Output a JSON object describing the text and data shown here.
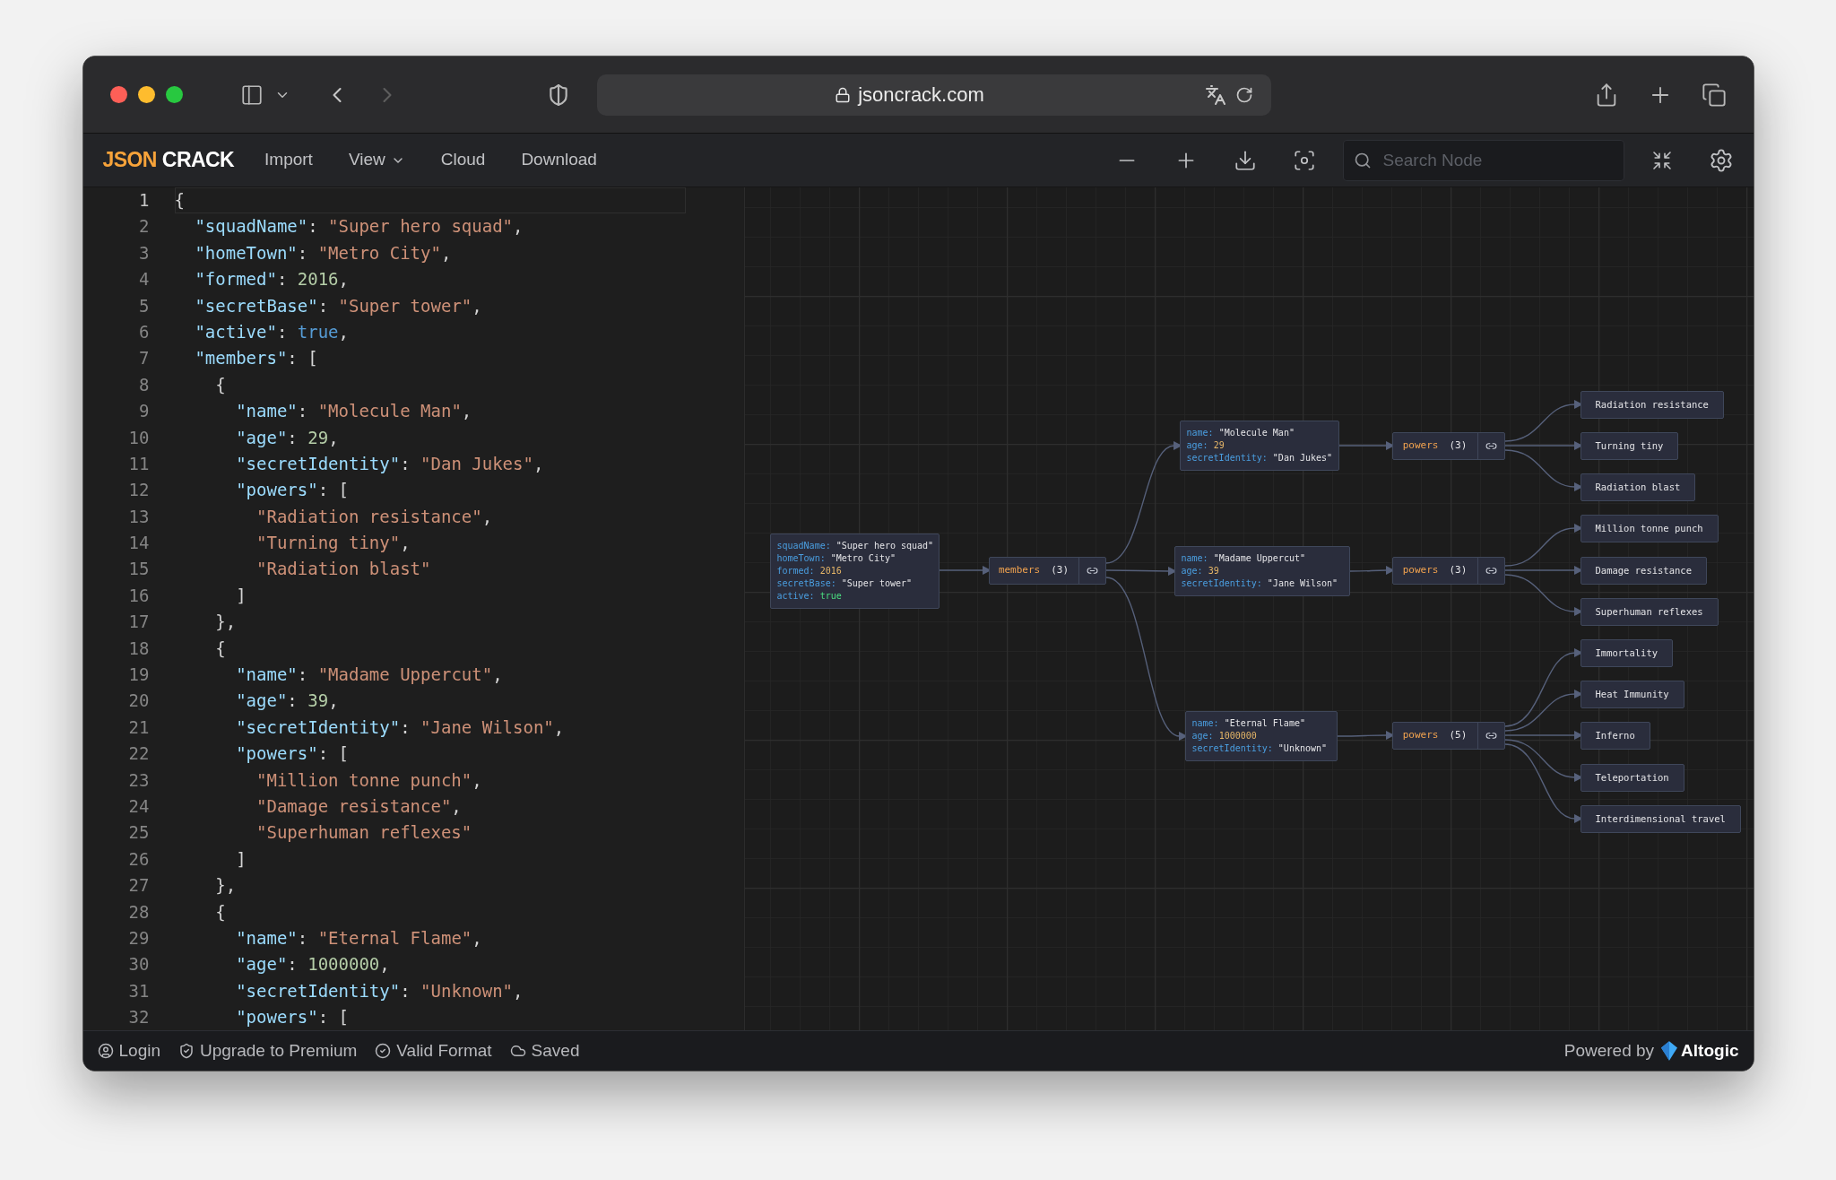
{
  "browser": {
    "url": "jsoncrack.com",
    "forward_disabled": true
  },
  "toolbar": {
    "logo_accent": "JSON",
    "logo_rest": "CRACK",
    "menu": [
      {
        "label": "Import",
        "dropdown": false
      },
      {
        "label": "View",
        "dropdown": true
      },
      {
        "label": "Cloud",
        "dropdown": false
      },
      {
        "label": "Download",
        "dropdown": false
      }
    ],
    "search": {
      "placeholder": "Search Node"
    }
  },
  "editor": {
    "lines": [
      {
        "number": "1",
        "current": true,
        "tokens": [
          {
            "kind": "punct",
            "text": "{"
          }
        ]
      },
      {
        "number": "2",
        "current": false,
        "tokens": [
          {
            "kind": "key",
            "text": "  \"squadName\""
          },
          {
            "kind": "punct",
            "text": ": "
          },
          {
            "kind": "string",
            "text": "\"Super hero squad\""
          },
          {
            "kind": "punct",
            "text": ","
          }
        ]
      },
      {
        "number": "3",
        "current": false,
        "tokens": [
          {
            "kind": "key",
            "text": "  \"homeTown\""
          },
          {
            "kind": "punct",
            "text": ": "
          },
          {
            "kind": "string",
            "text": "\"Metro City\""
          },
          {
            "kind": "punct",
            "text": ","
          }
        ]
      },
      {
        "number": "4",
        "current": false,
        "tokens": [
          {
            "kind": "key",
            "text": "  \"formed\""
          },
          {
            "kind": "punct",
            "text": ": "
          },
          {
            "kind": "number",
            "text": "2016"
          },
          {
            "kind": "punct",
            "text": ","
          }
        ]
      },
      {
        "number": "5",
        "current": false,
        "tokens": [
          {
            "kind": "key",
            "text": "  \"secretBase\""
          },
          {
            "kind": "punct",
            "text": ": "
          },
          {
            "kind": "string",
            "text": "\"Super tower\""
          },
          {
            "kind": "punct",
            "text": ","
          }
        ]
      },
      {
        "number": "6",
        "current": false,
        "tokens": [
          {
            "kind": "key",
            "text": "  \"active\""
          },
          {
            "kind": "punct",
            "text": ": "
          },
          {
            "kind": "bool",
            "text": "true"
          },
          {
            "kind": "punct",
            "text": ","
          }
        ]
      },
      {
        "number": "7",
        "current": false,
        "tokens": [
          {
            "kind": "key",
            "text": "  \"members\""
          },
          {
            "kind": "punct",
            "text": ": ["
          }
        ]
      },
      {
        "number": "8",
        "current": false,
        "tokens": [
          {
            "kind": "punct",
            "text": "    {"
          }
        ]
      },
      {
        "number": "9",
        "current": false,
        "tokens": [
          {
            "kind": "key",
            "text": "      \"name\""
          },
          {
            "kind": "punct",
            "text": ": "
          },
          {
            "kind": "string",
            "text": "\"Molecule Man\""
          },
          {
            "kind": "punct",
            "text": ","
          }
        ]
      },
      {
        "number": "10",
        "current": false,
        "tokens": [
          {
            "kind": "key",
            "text": "      \"age\""
          },
          {
            "kind": "punct",
            "text": ": "
          },
          {
            "kind": "number",
            "text": "29"
          },
          {
            "kind": "punct",
            "text": ","
          }
        ]
      },
      {
        "number": "11",
        "current": false,
        "tokens": [
          {
            "kind": "key",
            "text": "      \"secretIdentity\""
          },
          {
            "kind": "punct",
            "text": ": "
          },
          {
            "kind": "string",
            "text": "\"Dan Jukes\""
          },
          {
            "kind": "punct",
            "text": ","
          }
        ]
      },
      {
        "number": "12",
        "current": false,
        "tokens": [
          {
            "kind": "key",
            "text": "      \"powers\""
          },
          {
            "kind": "punct",
            "text": ": ["
          }
        ]
      },
      {
        "number": "13",
        "current": false,
        "tokens": [
          {
            "kind": "string",
            "text": "        \"Radiation resistance\""
          },
          {
            "kind": "punct",
            "text": ","
          }
        ]
      },
      {
        "number": "14",
        "current": false,
        "tokens": [
          {
            "kind": "string",
            "text": "        \"Turning tiny\""
          },
          {
            "kind": "punct",
            "text": ","
          }
        ]
      },
      {
        "number": "15",
        "current": false,
        "tokens": [
          {
            "kind": "string",
            "text": "        \"Radiation blast\""
          }
        ]
      },
      {
        "number": "16",
        "current": false,
        "tokens": [
          {
            "kind": "punct",
            "text": "      ]"
          }
        ]
      },
      {
        "number": "17",
        "current": false,
        "tokens": [
          {
            "kind": "punct",
            "text": "    },"
          }
        ]
      },
      {
        "number": "18",
        "current": false,
        "tokens": [
          {
            "kind": "punct",
            "text": "    {"
          }
        ]
      },
      {
        "number": "19",
        "current": false,
        "tokens": [
          {
            "kind": "key",
            "text": "      \"name\""
          },
          {
            "kind": "punct",
            "text": ": "
          },
          {
            "kind": "string",
            "text": "\"Madame Uppercut\""
          },
          {
            "kind": "punct",
            "text": ","
          }
        ]
      },
      {
        "number": "20",
        "current": false,
        "tokens": [
          {
            "kind": "key",
            "text": "      \"age\""
          },
          {
            "kind": "punct",
            "text": ": "
          },
          {
            "kind": "number",
            "text": "39"
          },
          {
            "kind": "punct",
            "text": ","
          }
        ]
      },
      {
        "number": "21",
        "current": false,
        "tokens": [
          {
            "kind": "key",
            "text": "      \"secretIdentity\""
          },
          {
            "kind": "punct",
            "text": ": "
          },
          {
            "kind": "string",
            "text": "\"Jane Wilson\""
          },
          {
            "kind": "punct",
            "text": ","
          }
        ]
      },
      {
        "number": "22",
        "current": false,
        "tokens": [
          {
            "kind": "key",
            "text": "      \"powers\""
          },
          {
            "kind": "punct",
            "text": ": ["
          }
        ]
      },
      {
        "number": "23",
        "current": false,
        "tokens": [
          {
            "kind": "string",
            "text": "        \"Million tonne punch\""
          },
          {
            "kind": "punct",
            "text": ","
          }
        ]
      },
      {
        "number": "24",
        "current": false,
        "tokens": [
          {
            "kind": "string",
            "text": "        \"Damage resistance\""
          },
          {
            "kind": "punct",
            "text": ","
          }
        ]
      },
      {
        "number": "25",
        "current": false,
        "tokens": [
          {
            "kind": "string",
            "text": "        \"Superhuman reflexes\""
          }
        ]
      },
      {
        "number": "26",
        "current": false,
        "tokens": [
          {
            "kind": "punct",
            "text": "      ]"
          }
        ]
      },
      {
        "number": "27",
        "current": false,
        "tokens": [
          {
            "kind": "punct",
            "text": "    },"
          }
        ]
      },
      {
        "number": "28",
        "current": false,
        "tokens": [
          {
            "kind": "punct",
            "text": "    {"
          }
        ]
      },
      {
        "number": "29",
        "current": false,
        "tokens": [
          {
            "kind": "key",
            "text": "      \"name\""
          },
          {
            "kind": "punct",
            "text": ": "
          },
          {
            "kind": "string",
            "text": "\"Eternal Flame\""
          },
          {
            "kind": "punct",
            "text": ","
          }
        ]
      },
      {
        "number": "30",
        "current": false,
        "tokens": [
          {
            "kind": "key",
            "text": "      \"age\""
          },
          {
            "kind": "punct",
            "text": ": "
          },
          {
            "kind": "number",
            "text": "1000000"
          },
          {
            "kind": "punct",
            "text": ","
          }
        ]
      },
      {
        "number": "31",
        "current": false,
        "tokens": [
          {
            "kind": "key",
            "text": "      \"secretIdentity\""
          },
          {
            "kind": "punct",
            "text": ": "
          },
          {
            "kind": "string",
            "text": "\"Unknown\""
          },
          {
            "kind": "punct",
            "text": ","
          }
        ]
      },
      {
        "number": "32",
        "current": false,
        "tokens": [
          {
            "kind": "key",
            "text": "      \"powers\""
          },
          {
            "kind": "punct",
            "text": ": ["
          }
        ]
      }
    ]
  },
  "graph": {
    "root": {
      "fields": [
        {
          "key": "squadName:",
          "value": "\"Super hero squad\"",
          "kind": "string"
        },
        {
          "key": "homeTown:",
          "value": "\"Metro City\"",
          "kind": "string"
        },
        {
          "key": "formed:",
          "value": "2016",
          "kind": "number"
        },
        {
          "key": "secretBase:",
          "value": "\"Super tower\"",
          "kind": "string"
        },
        {
          "key": "active:",
          "value": "true",
          "kind": "bool"
        }
      ]
    },
    "members_node": {
      "label": "members",
      "count": "(3)"
    },
    "members": [
      {
        "fields": [
          {
            "key": "name:",
            "value": "\"Molecule Man\"",
            "kind": "string"
          },
          {
            "key": "age:",
            "value": "29",
            "kind": "number"
          },
          {
            "key": "secretIdentity:",
            "value": "\"Dan Jukes\"",
            "kind": "string"
          }
        ],
        "powers_node": {
          "label": "powers",
          "count": "(3)"
        },
        "powers": [
          "Radiation resistance",
          "Turning tiny",
          "Radiation blast"
        ]
      },
      {
        "fields": [
          {
            "key": "name:",
            "value": "\"Madame Uppercut\"",
            "kind": "string"
          },
          {
            "key": "age:",
            "value": "39",
            "kind": "number"
          },
          {
            "key": "secretIdentity:",
            "value": "\"Jane Wilson\"",
            "kind": "string"
          }
        ],
        "powers_node": {
          "label": "powers",
          "count": "(3)"
        },
        "powers": [
          "Million tonne punch",
          "Damage resistance",
          "Superhuman reflexes"
        ]
      },
      {
        "fields": [
          {
            "key": "name:",
            "value": "\"Eternal Flame\"",
            "kind": "string"
          },
          {
            "key": "age:",
            "value": "1000000",
            "kind": "number"
          },
          {
            "key": "secretIdentity:",
            "value": "\"Unknown\"",
            "kind": "string"
          }
        ],
        "powers_node": {
          "label": "powers",
          "count": "(5)"
        },
        "powers": [
          "Immortality",
          "Heat Immunity",
          "Inferno",
          "Teleportation",
          "Interdimensional travel"
        ]
      }
    ]
  },
  "status_bar": {
    "items": [
      {
        "label": "Login",
        "kind": "user"
      },
      {
        "label": "Upgrade to Premium",
        "kind": "premium"
      },
      {
        "label": "Valid Format",
        "kind": "valid"
      },
      {
        "label": "Saved",
        "kind": "saved"
      }
    ],
    "powered_by": "Powered by",
    "brand": "Altogic"
  }
}
